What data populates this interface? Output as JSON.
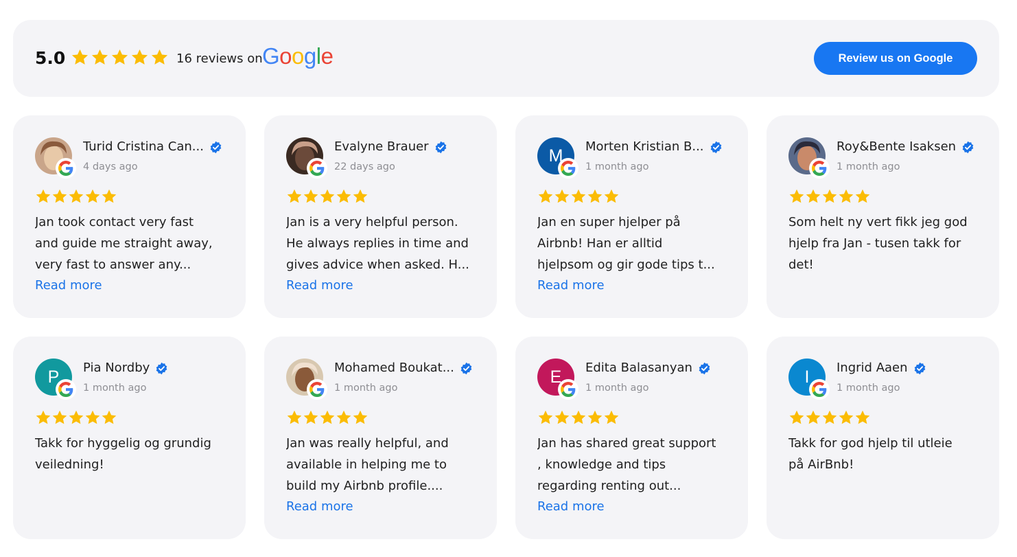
{
  "summary": {
    "score": "5.0",
    "stars": 5,
    "reviews_text": "16 reviews on",
    "google_letters": [
      {
        "ch": "G",
        "color": "#4285F4"
      },
      {
        "ch": "o",
        "color": "#EA4335"
      },
      {
        "ch": "o",
        "color": "#FBBC05"
      },
      {
        "ch": "g",
        "color": "#4285F4"
      },
      {
        "ch": "l",
        "color": "#34A853"
      },
      {
        "ch": "e",
        "color": "#EA4335"
      }
    ],
    "cta_label": "Review us on Google"
  },
  "colors": {
    "star": "#FBBC04",
    "accent": "#1877F2",
    "card_bg": "#F4F4F7",
    "verified": "#1A73E8"
  },
  "reviews": [
    {
      "name": "Turid Cristina Can...",
      "date": "4 days ago",
      "rating": 5,
      "avatar": {
        "type": "photo",
        "palette": [
          "#c9a58a",
          "#e8c9a8",
          "#8a5a3c"
        ]
      },
      "lines": [
        "Jan took contact very fast",
        "and guide me straight away,",
        "very fast to answer any..."
      ],
      "read_more": "Read more"
    },
    {
      "name": "Evalyne Brauer",
      "date": "22 days ago",
      "rating": 5,
      "avatar": {
        "type": "photo",
        "palette": [
          "#3a2a22",
          "#6b4a3a",
          "#c9a08a"
        ]
      },
      "lines": [
        "Jan is a very helpful person.",
        "He always replies in time and",
        "gives advice when asked. H..."
      ],
      "read_more": "Read more"
    },
    {
      "name": "Morten Kristian B...",
      "date": "1 month ago",
      "rating": 5,
      "avatar": {
        "type": "initial",
        "letter": "M",
        "color": "#0b5aa6"
      },
      "lines": [
        "Jan en super hjelper på",
        "Airbnb! Han er alltid",
        "hjelpsom og gir gode tips t..."
      ],
      "read_more": "Read more"
    },
    {
      "name": "Roy&Bente Isaksen",
      "date": "1 month ago",
      "rating": 5,
      "avatar": {
        "type": "photo",
        "palette": [
          "#5a6a8a",
          "#c98a6a",
          "#2a2a3a"
        ]
      },
      "lines": [
        "Som helt ny vert fikk jeg god",
        "hjelp fra Jan - tusen takk for",
        "det!"
      ],
      "read_more": ""
    },
    {
      "name": "Pia Nordby",
      "date": "1 month ago",
      "rating": 5,
      "avatar": {
        "type": "initial",
        "letter": "P",
        "color": "#11999e"
      },
      "lines": [
        "Takk for hyggelig og grundig",
        "veiledning!"
      ],
      "read_more": ""
    },
    {
      "name": "Mohamed Boukat...",
      "date": "1 month ago",
      "rating": 5,
      "avatar": {
        "type": "photo",
        "palette": [
          "#d8c8b0",
          "#8a5a3a",
          "#f0e0d0"
        ]
      },
      "lines": [
        "Jan was really helpful, and",
        "available in helping me to",
        "build my Airbnb profile...."
      ],
      "read_more": "Read more"
    },
    {
      "name": "Edita Balasanyan",
      "date": "1 month ago",
      "rating": 5,
      "avatar": {
        "type": "initial",
        "letter": "E",
        "color": "#c2185b"
      },
      "lines": [
        "Jan has shared great support",
        ", knowledge and tips",
        "regarding renting out..."
      ],
      "read_more": "Read more"
    },
    {
      "name": "Ingrid Aaen",
      "date": "1 month ago",
      "rating": 5,
      "avatar": {
        "type": "initial",
        "letter": "I",
        "color": "#0a88d0"
      },
      "lines": [
        "Takk for god hjelp til utleie",
        "på AirBnb!"
      ],
      "read_more": ""
    }
  ]
}
